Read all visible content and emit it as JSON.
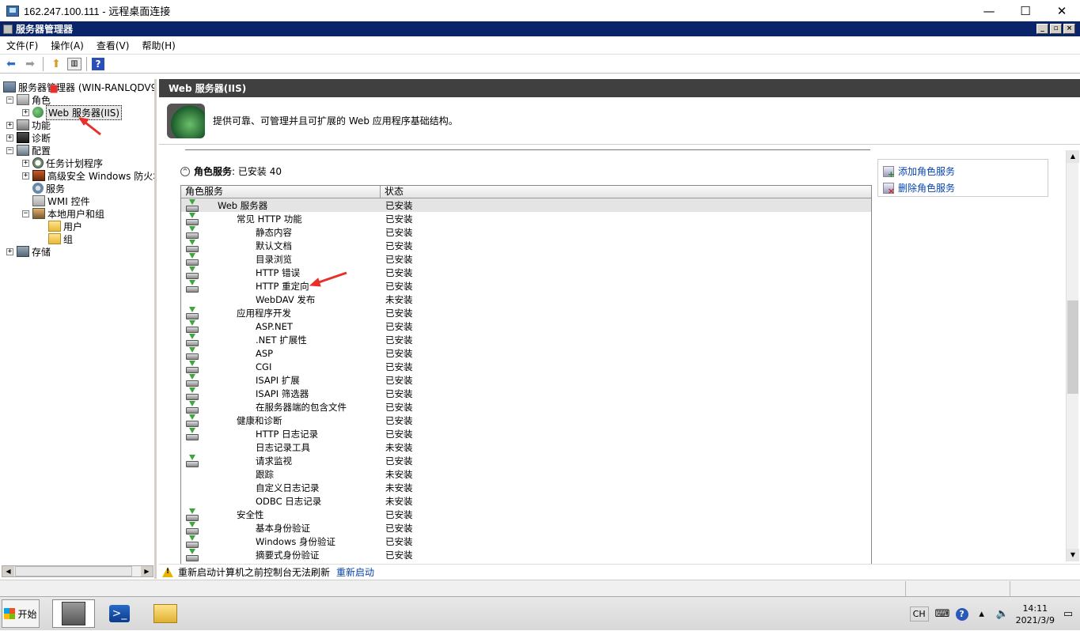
{
  "window": {
    "title": "162.247.100.111 - 远程桌面连接",
    "minimize": "—",
    "maximize": "☐",
    "close": "✕"
  },
  "app": {
    "title": "服务器管理器"
  },
  "menu": [
    {
      "label": "文件(F)"
    },
    {
      "label": "操作(A)"
    },
    {
      "label": "查看(V)"
    },
    {
      "label": "帮助(H)"
    }
  ],
  "tree": {
    "root": "服务器管理器 (WIN-RANLQDV993",
    "roles": "角色",
    "web_server": "Web 服务器(IIS)",
    "features": "功能",
    "diagnostics": "诊断",
    "config": "配置",
    "task_scheduler": "任务计划程序",
    "firewall": "高级安全 Windows 防火墙",
    "services": "服务",
    "wmi": "WMI 控件",
    "local_users": "本地用户和组",
    "users": "用户",
    "groups": "组",
    "storage": "存储"
  },
  "right": {
    "header": "Web 服务器(IIS)",
    "description": "提供可靠、可管理并且可扩展的 Web 应用程序基础结构。",
    "section_title": "角色服务",
    "section_suffix": ": 已安装 40",
    "col_name": "角色服务",
    "col_status": "状态",
    "tasks": {
      "add": "添加角色服务",
      "remove": "删除角色服务"
    },
    "warning": "重新启动计算机之前控制台无法刷新",
    "restart_link": "重新启动"
  },
  "services": [
    {
      "name": "Web 服务器",
      "status": "已安装",
      "level": 0,
      "installed": true
    },
    {
      "name": "常见 HTTP 功能",
      "status": "已安装",
      "level": 1,
      "installed": true
    },
    {
      "name": "静态内容",
      "status": "已安装",
      "level": 2,
      "installed": true
    },
    {
      "name": "默认文档",
      "status": "已安装",
      "level": 2,
      "installed": true
    },
    {
      "name": "目录浏览",
      "status": "已安装",
      "level": 2,
      "installed": true
    },
    {
      "name": "HTTP 错误",
      "status": "已安装",
      "level": 2,
      "installed": true
    },
    {
      "name": "HTTP 重定向",
      "status": "已安装",
      "level": 2,
      "installed": true
    },
    {
      "name": "WebDAV 发布",
      "status": "未安装",
      "level": 2,
      "installed": false
    },
    {
      "name": "应用程序开发",
      "status": "已安装",
      "level": 1,
      "installed": true
    },
    {
      "name": "ASP.NET",
      "status": "已安装",
      "level": 2,
      "installed": true
    },
    {
      "name": ".NET 扩展性",
      "status": "已安装",
      "level": 2,
      "installed": true
    },
    {
      "name": "ASP",
      "status": "已安装",
      "level": 2,
      "installed": true
    },
    {
      "name": "CGI",
      "status": "已安装",
      "level": 2,
      "installed": true
    },
    {
      "name": "ISAPI 扩展",
      "status": "已安装",
      "level": 2,
      "installed": true
    },
    {
      "name": "ISAPI 筛选器",
      "status": "已安装",
      "level": 2,
      "installed": true
    },
    {
      "name": "在服务器端的包含文件",
      "status": "已安装",
      "level": 2,
      "installed": true
    },
    {
      "name": "健康和诊断",
      "status": "已安装",
      "level": 1,
      "installed": true
    },
    {
      "name": "HTTP 日志记录",
      "status": "已安装",
      "level": 2,
      "installed": true
    },
    {
      "name": "日志记录工具",
      "status": "未安装",
      "level": 2,
      "installed": false
    },
    {
      "name": "请求监视",
      "status": "已安装",
      "level": 2,
      "installed": true
    },
    {
      "name": "跟踪",
      "status": "未安装",
      "level": 2,
      "installed": false
    },
    {
      "name": "自定义日志记录",
      "status": "未安装",
      "level": 2,
      "installed": false
    },
    {
      "name": "ODBC 日志记录",
      "status": "未安装",
      "level": 2,
      "installed": false
    },
    {
      "name": "安全性",
      "status": "已安装",
      "level": 1,
      "installed": true
    },
    {
      "name": "基本身份验证",
      "status": "已安装",
      "level": 2,
      "installed": true
    },
    {
      "name": "Windows 身份验证",
      "status": "已安装",
      "level": 2,
      "installed": true
    },
    {
      "name": "摘要式身份验证",
      "status": "已安装",
      "level": 2,
      "installed": true
    }
  ],
  "taskbar": {
    "start": "开始",
    "lang": "CH",
    "time": "14:11",
    "date": "2021/3/9"
  },
  "colors": {
    "app_title_bg": "#0a246a",
    "header_bg": "#404040",
    "link": "#0645ad",
    "annotation_arrow": "#e8302a"
  }
}
